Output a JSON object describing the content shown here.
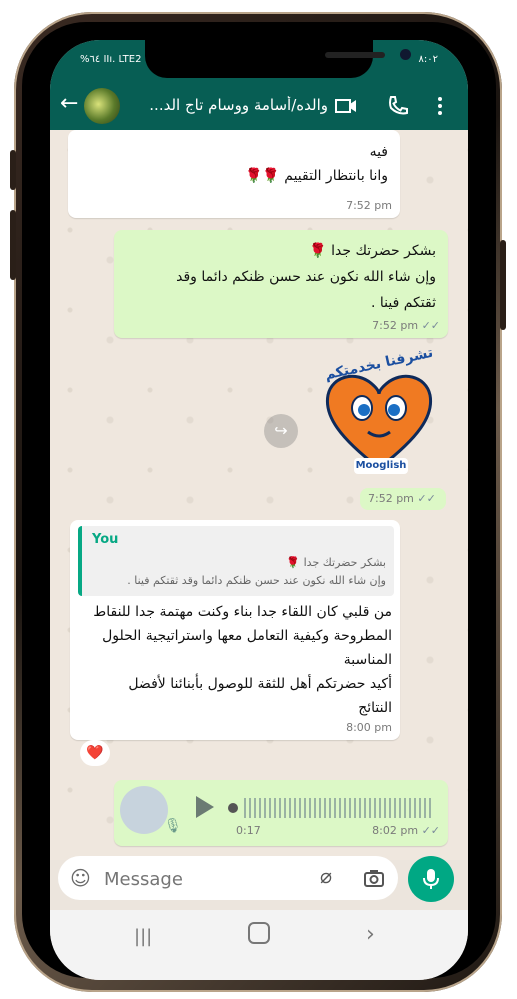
{
  "status_bar": {
    "left": "%٦٤ ⅠⅠı. LTE2",
    "right": "٨:٠٢"
  },
  "chat": {
    "title": "والده/أسامة ووسام تاج الد...",
    "back_glyph": "←"
  },
  "messages": [
    {
      "type": "incoming",
      "lines": [
        "فيه",
        "وانا بانتظار التقييم 🌹🌹"
      ],
      "time": "7:52 pm"
    },
    {
      "type": "outgoing",
      "lines": [
        "بشكر حضرتك جدا 🌹",
        "وإن شاء الله نكون عند حسن ظنكم دائما وقد",
        "ثقتكم فينا ."
      ],
      "time": "7:52 pm"
    },
    {
      "type": "sticker",
      "sticker_text": "تشرفنا بخدمتكم",
      "brand": "Mooglish",
      "time": "7:52 pm"
    },
    {
      "type": "reply",
      "quote_author": "You",
      "quote_lines": [
        "بشكر حضرتك جدا 🌹",
        "وإن شاء الله نكون عند حسن ظنكم دائما وقد ثقتكم فينا ."
      ],
      "lines": [
        "من قلبي كان اللقاء جدا بناء وكنت مهتمة جدا للنقاط",
        "المطروحة وكيفية التعامل معها واستراتيجية الحلول",
        "المناسبة",
        "أكيد حضرتكم أهل للثقة للوصول بأبنائنا لأفضل",
        "النتائج"
      ],
      "time": "8:00 pm",
      "reaction": "❤️"
    },
    {
      "type": "voice",
      "duration": "0:17",
      "time": "8:02 pm"
    }
  ],
  "composer": {
    "placeholder": "Message"
  },
  "colors": {
    "header": "#075e54",
    "outgoing": "#dcf8c6",
    "accent": "#00a884"
  },
  "icons": [
    "back-arrow-icon",
    "video-call-icon",
    "voice-call-icon",
    "menu-dots-icon",
    "emoji-icon",
    "attach-icon",
    "camera-icon",
    "mic-icon",
    "forward-icon",
    "play-icon"
  ]
}
